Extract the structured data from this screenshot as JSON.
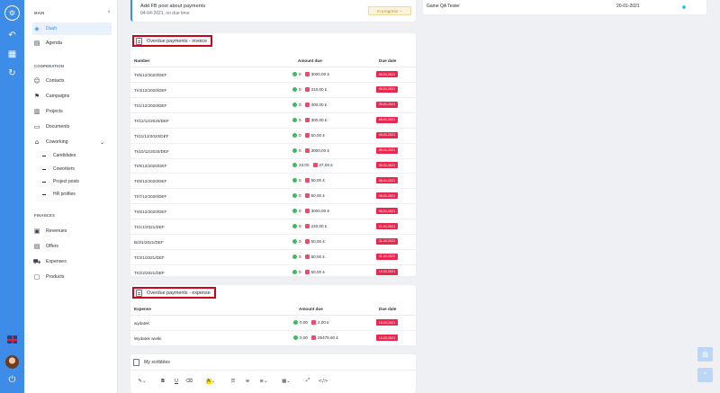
{
  "rail": {
    "logo_icon": "brain-logo-icon",
    "icons": [
      "back-arrow-icon",
      "dashboard-icon",
      "refresh-icon"
    ],
    "language": "UK flag",
    "brand_color": "#3d8ce8"
  },
  "sidebar": {
    "main_label": "MAIN",
    "main_items": [
      {
        "label": "Dash",
        "icon": "dashboard-icon",
        "active": true
      },
      {
        "label": "Agenda",
        "icon": "calendar-icon"
      }
    ],
    "cooperation_label": "COOPERATION",
    "cooperation_items": [
      {
        "label": "Contacts",
        "icon": "contacts-icon"
      },
      {
        "label": "Campaigns",
        "icon": "megaphone-icon"
      },
      {
        "label": "Projects",
        "icon": "clipboard-icon"
      },
      {
        "label": "Documents",
        "icon": "document-icon"
      },
      {
        "label": "Coworking",
        "icon": "chair-icon"
      }
    ],
    "coworking_sub": [
      "Candidates",
      "Coworkers",
      "Project posts",
      "HR profiles"
    ],
    "finances_label": "FINANCES",
    "finance_items": [
      {
        "label": "Revenues",
        "icon": "revenue-icon"
      },
      {
        "label": "Offers",
        "icon": "offers-icon"
      },
      {
        "label": "Expenses",
        "icon": "cart-icon"
      },
      {
        "label": "Products",
        "icon": "box-icon"
      }
    ]
  },
  "task": {
    "title": "Add FB post about payments",
    "subtitle": "04-04-2021, no due time",
    "status": "In progress"
  },
  "right_row": {
    "title": "Game QA Tester",
    "date": "20-01-2021"
  },
  "invoice": {
    "title": "Overdue payments - invoice",
    "col_number": "Number",
    "col_amount": "Amount due",
    "col_due": "Due date",
    "rows": [
      {
        "number": "TI/5/12/2020/DEF",
        "paid": "0",
        "due_amount": "3000,00 £",
        "due": "05-01-2021"
      },
      {
        "number": "TI/4/12/2020/DEF",
        "paid": "0",
        "due_amount": "210,00 £",
        "due": "05-01-2021"
      },
      {
        "number": "TI/1/12/2020/DEF",
        "paid": "0",
        "due_amount": "300,00 £",
        "due": "05-01-2021"
      },
      {
        "number": "TI/12/12/2020/DEF",
        "paid": "0",
        "due_amount": "300,00 £",
        "due": "05-01-2021"
      },
      {
        "number": "TI/11/12/2020/DEF",
        "paid": "0",
        "due_amount": "50,00 £",
        "due": "05-01-2021"
      },
      {
        "number": "TI/10/12/2020/DEF",
        "paid": "0",
        "due_amount": "3000,00 £",
        "due": "05-01-2021"
      },
      {
        "number": "TI/9/12/2020/DEF",
        "paid": "23,00",
        "due_amount": "27,00 £",
        "due": "05-01-2021"
      },
      {
        "number": "TI/8/12/2020/DEF",
        "paid": "0",
        "due_amount": "50,00 £",
        "due": "05-01-2021"
      },
      {
        "number": "TI/7/12/2020/DEF",
        "paid": "0",
        "due_amount": "50,00 £",
        "due": "05-01-2021"
      },
      {
        "number": "TI/6/12/2020/DEF",
        "paid": "0",
        "due_amount": "3000,00 £",
        "due": "05-01-2021"
      },
      {
        "number": "TI/1/1/2021/DEF",
        "paid": "0",
        "due_amount": "240,00 £",
        "due": "21-01-2021"
      },
      {
        "number": "B/2/1/2021/DEF",
        "paid": "0",
        "due_amount": "50,00 £",
        "due": "11-02-2021"
      },
      {
        "number": "TI/3/1/2021/DEF",
        "paid": "0",
        "due_amount": "50,00 £",
        "due": "11-02-2021"
      },
      {
        "number": "TI/2/2/2021/DEF",
        "paid": "0",
        "due_amount": "50,00 £",
        "due": "19-02-2021"
      }
    ]
  },
  "expense": {
    "title": "Overdue payments - expense",
    "col_expense": "Expense",
    "col_amount": "Amount due",
    "col_due": "Due date",
    "rows": [
      {
        "name": "wydatek",
        "paid": "0,00",
        "due_amount": "2,00 £",
        "due": "16-03-2021"
      },
      {
        "name": "Wydatek wielki",
        "paid": "0,00",
        "due_amount": "25479,60 £",
        "due": "16-03-2021"
      }
    ]
  },
  "scribbles": {
    "title": "My scribbles",
    "toolbar": [
      "magic-wand-icon",
      "bold-icon",
      "underline-icon",
      "eraser-icon",
      "text-color-icon",
      "unordered-list-icon",
      "ordered-list-icon",
      "align-icon",
      "table-icon",
      "fullscreen-icon",
      "code-icon"
    ]
  },
  "fabs": [
    "notes-icon",
    "scroll-up-icon"
  ],
  "colors": {
    "danger": "#e8284f",
    "success": "#3dbb5c",
    "warning": "#c79012",
    "highlight": "#d0021b"
  }
}
